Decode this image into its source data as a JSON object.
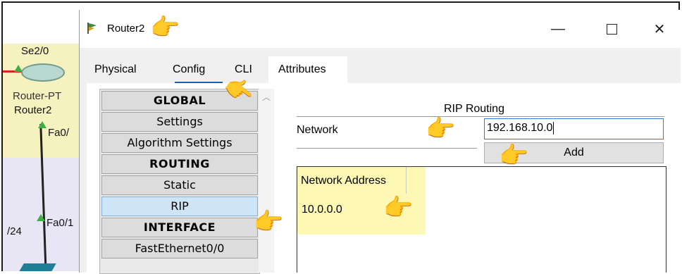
{
  "workspace": {
    "port_se": "Se2/0",
    "router_name": "Router-PT",
    "router_label": "Router2",
    "port_fa0_top": "Fa0/",
    "subnet_fragment": "/24",
    "port_fa0_bottom": "Fa0/1"
  },
  "window": {
    "title": "Router2",
    "minimize": "—",
    "close": "✕"
  },
  "tabs": [
    {
      "label": "Physical"
    },
    {
      "label": "Config"
    },
    {
      "label": "CLI"
    },
    {
      "label": "Attributes"
    }
  ],
  "nav": {
    "items": [
      {
        "label": "GLOBAL",
        "type": "header"
      },
      {
        "label": "Settings",
        "type": "item"
      },
      {
        "label": "Algorithm Settings",
        "type": "item"
      },
      {
        "label": "ROUTING",
        "type": "header"
      },
      {
        "label": "Static",
        "type": "item"
      },
      {
        "label": "RIP",
        "type": "item",
        "selected": true
      },
      {
        "label": "INTERFACE",
        "type": "header"
      },
      {
        "label": "FastEthernet0/0",
        "type": "item"
      }
    ]
  },
  "rip": {
    "title": "RIP Routing",
    "network_label": "Network",
    "network_value": "192.168.10.0",
    "add_label": "Add",
    "table_header": "Network Address",
    "rows": [
      "10.0.0.0"
    ]
  },
  "icons": {
    "pointer": "👉"
  },
  "colors": {
    "highlight": "#fdf8b4",
    "selected": "#cde5f7",
    "input_border": "#2f7ad8"
  }
}
